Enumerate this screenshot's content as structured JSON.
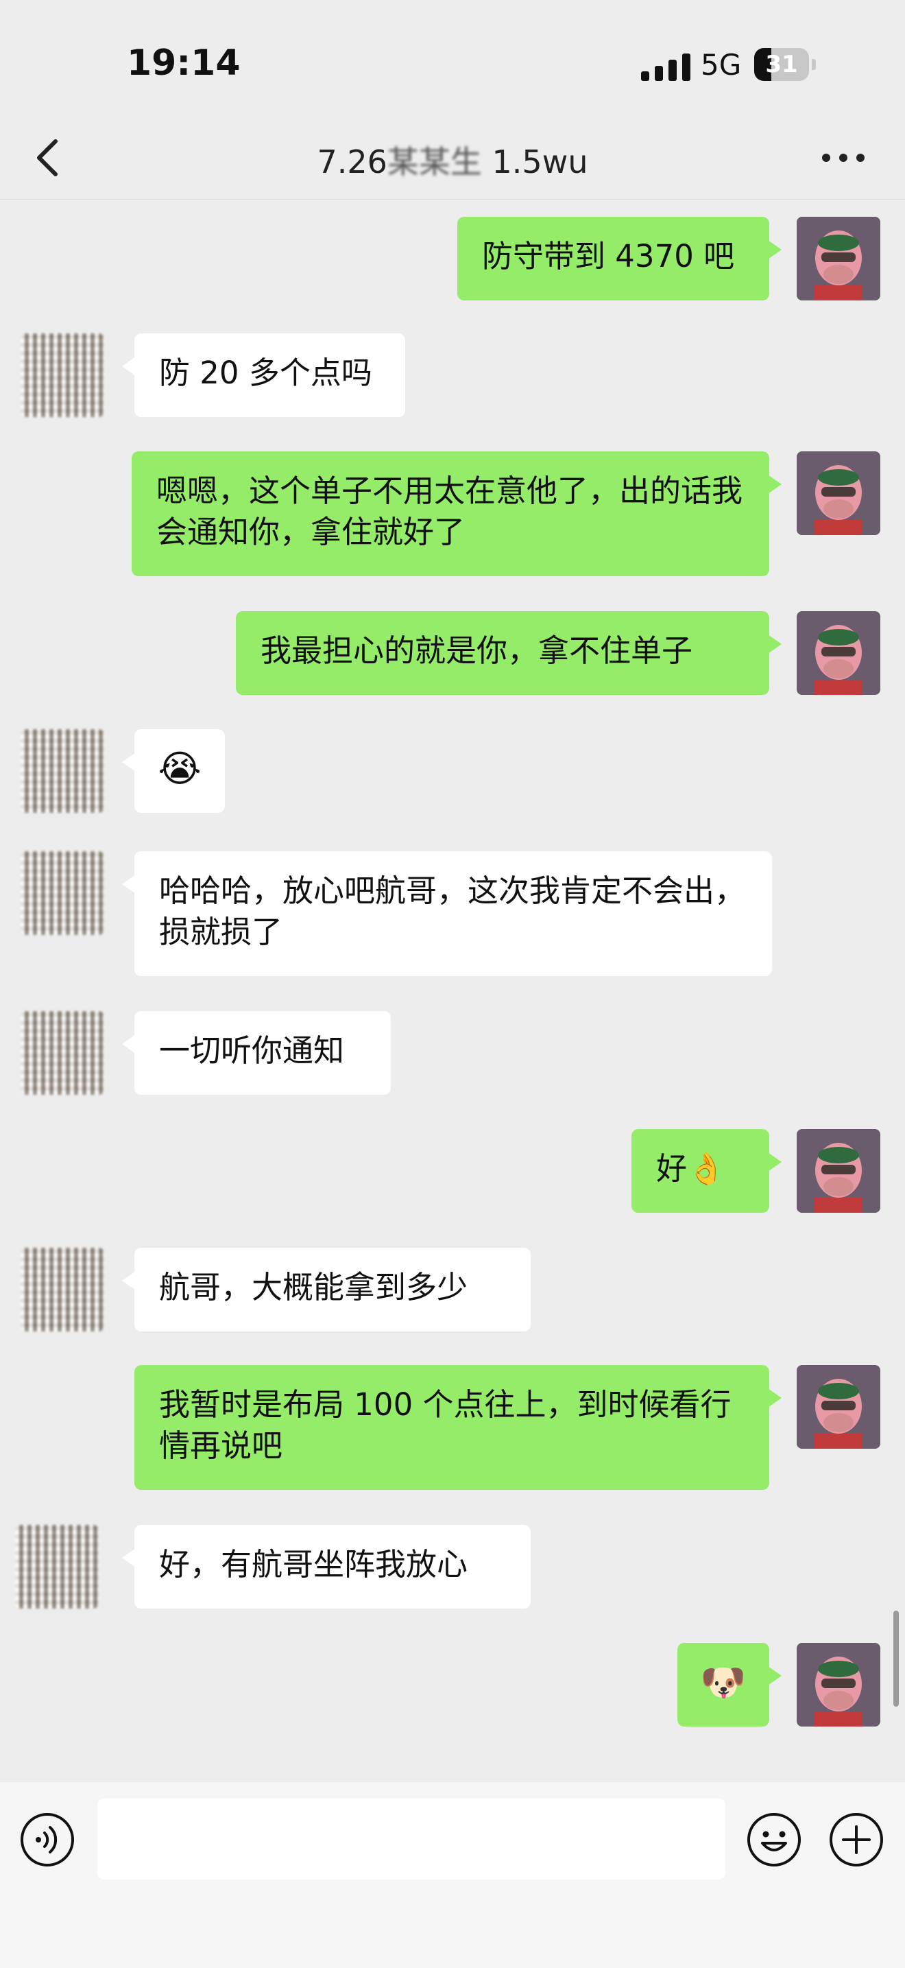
{
  "status_bar": {
    "time": "19:14",
    "network": "5G",
    "battery_level": "31",
    "battery_fraction": 0.31
  },
  "header": {
    "title_visible": "7.26",
    "title_obscured": "某某生",
    "title_suffix": " 1.5wu",
    "back_icon": "chevron-left-icon",
    "more_icon": "more-dots-icon"
  },
  "messages": [
    {
      "sender": "me",
      "text": "防守带到 4370 吧"
    },
    {
      "sender": "them",
      "text": "防 20 多个点吗"
    },
    {
      "sender": "me",
      "text": "嗯嗯，这个单子不用太在意他了，出的话我会通知你，拿住就好了"
    },
    {
      "sender": "me",
      "text": "我最担心的就是你，拿不住单子"
    },
    {
      "sender": "them",
      "text": "😭"
    },
    {
      "sender": "them",
      "text": "哈哈哈，放心吧航哥，这次我肯定不会出，损就损了"
    },
    {
      "sender": "them",
      "text": "一切听你通知"
    },
    {
      "sender": "me",
      "text": "好👌"
    },
    {
      "sender": "them",
      "text": "航哥，大概能拿到多少"
    },
    {
      "sender": "me",
      "text": "我暂时是布局 100 个点往上，到时候看行情再说吧"
    },
    {
      "sender": "them",
      "text": "好，有航哥坐阵我放心"
    },
    {
      "sender": "me",
      "text": "🐶"
    }
  ],
  "input_bar": {
    "voice_icon": "voice-icon",
    "emoji_icon": "emoji-smile-icon",
    "plus_icon": "plus-circle-icon",
    "placeholder": ""
  }
}
